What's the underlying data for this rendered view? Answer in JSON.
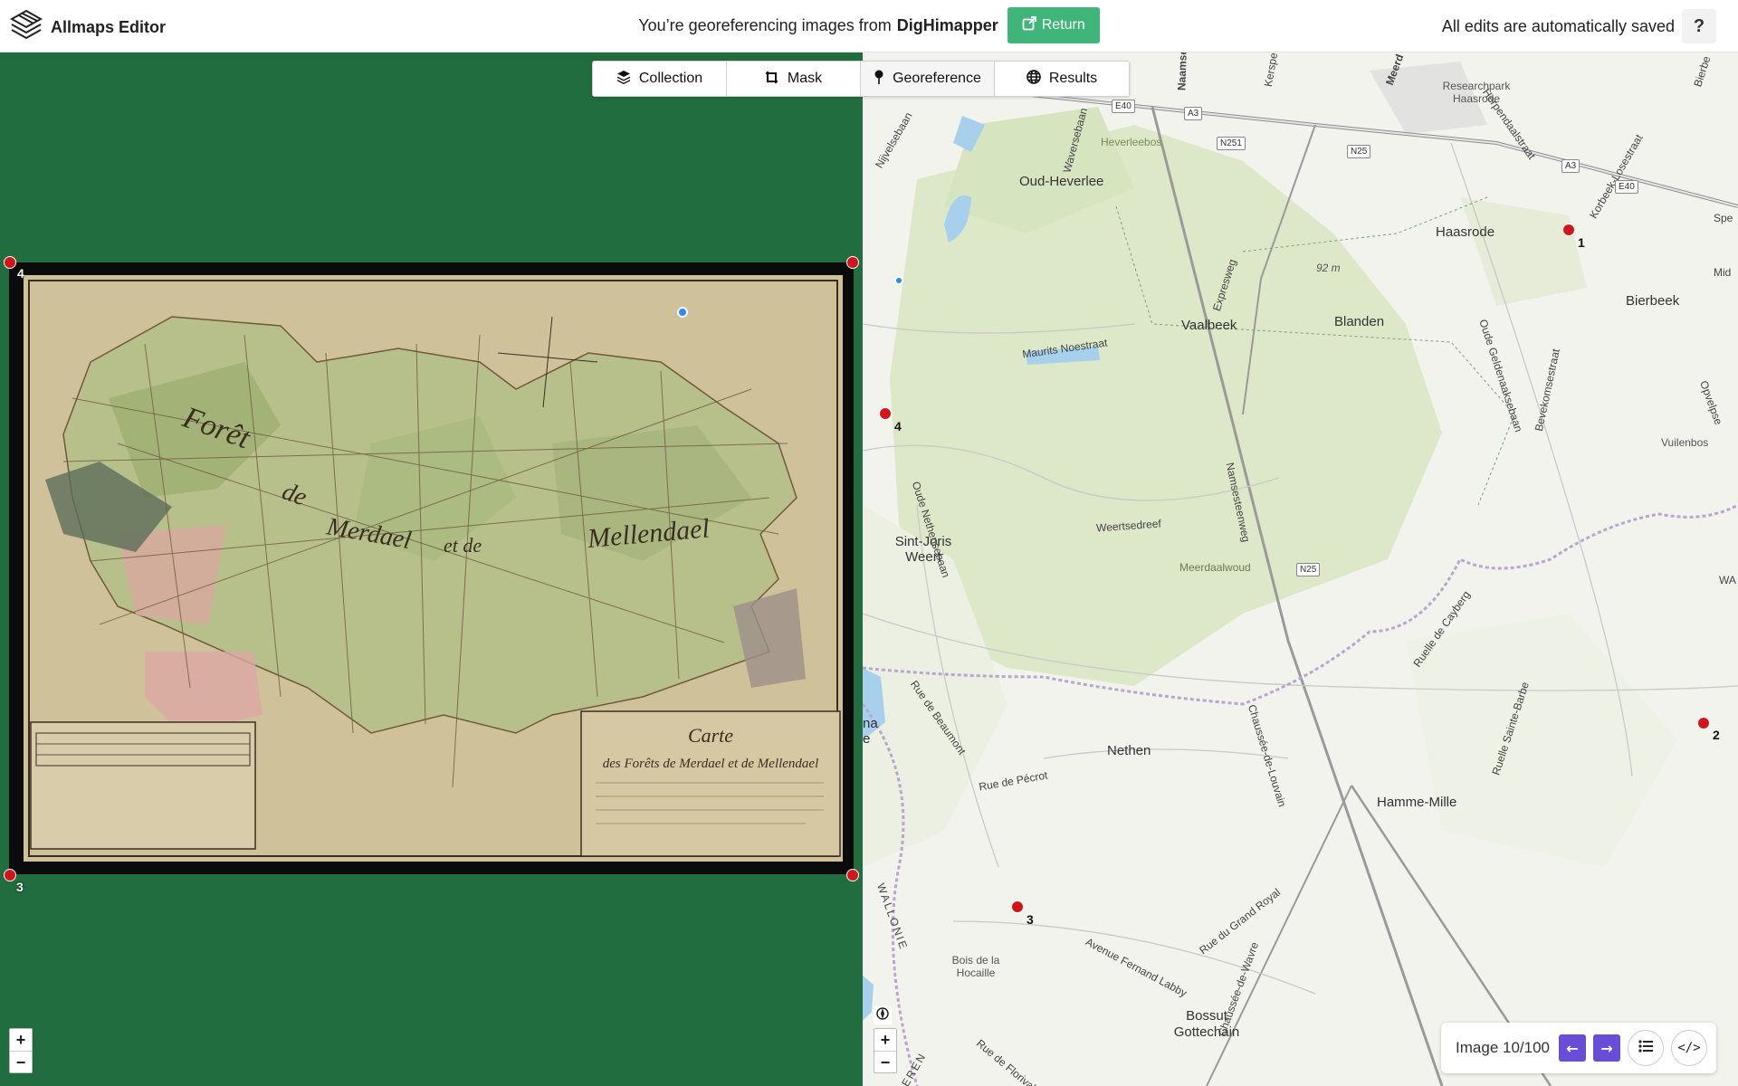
{
  "app": {
    "name": "Allmaps Editor",
    "message_prefix": "You’re georeferencing images from",
    "message_source": "DigHimapper",
    "return_label": "Return",
    "saved_status": "All edits are automatically saved",
    "help_label": "?"
  },
  "tabs": [
    {
      "label": "Collection",
      "icon": "layers-icon"
    },
    {
      "label": "Mask",
      "icon": "crop-icon"
    },
    {
      "label": "Georeference",
      "icon": "pin-icon"
    },
    {
      "label": "Results",
      "icon": "globe-icon"
    }
  ],
  "gcps_image": [
    {
      "label": "4"
    },
    {
      "label": "3"
    }
  ],
  "gcps_map": [
    {
      "label": "1"
    },
    {
      "label": "4"
    },
    {
      "label": "2"
    },
    {
      "label": "3"
    }
  ],
  "zoom": {
    "in": "+",
    "out": "−"
  },
  "map_labels": {
    "research_park": "Researchpark Haasrode",
    "heverleebos": "Heverleebos",
    "oud_heverlee": "Oud-Heverlee",
    "haasrode": "Haasrode",
    "bierbeek": "Bierbeek",
    "vaalbeek": "Vaalbeek",
    "blanden": "Blanden",
    "elev": "92 m",
    "sint_joris": "Sint-Joris Weert",
    "weertsedreef": "Weertsedreef",
    "meerdaalwoud": "Meerdaalwoud",
    "nethen": "Nethen",
    "hamme_mille": "Hamme-Mille",
    "bois": "Bois de la Hocaille",
    "bossut": "Bossut Gottechain",
    "vuilenbos": "Vuilenbos",
    "maurits": "Maurits Noestraat",
    "namsesteenweg": "Namsesteenweg",
    "chaussee": "Chaussée-de-Louvain",
    "rue_pecrot": "Rue de Pécrot",
    "rue_beaumont": "Rue de Beaumont",
    "avenue_labby": "Avenue Fernand Labby",
    "rue_grand_royal": "Rue du Grand Royal",
    "chaussee_wavre": "Chaussée-de-Wavre",
    "wallonie": "WALLONIE",
    "expresweg": "Expresweg",
    "oude_geldenaaksebaan": "Oude Geldenaaksebaan",
    "bevekomsestraat": "Bevekomsestraat",
    "ruelle_cayberg": "Ruelle de Cayberg",
    "ruelle_barbe": "Ruelle Sainte-Barbe",
    "oude_nethensebaan": "Oude Nethensebaan",
    "rue_florival": "Rue de Florival",
    "derenbaan": "NDEREN",
    "nijvelsebaan": "Nijvelsebaan",
    "waversebaan": "Waversebaan",
    "herpendaalstraat": "Herpendaalstraat",
    "korbeek": "Korbeek-Losestraat",
    "na_e": "na",
    "e": "e",
    "spe": "Spe",
    "mid": "Mid",
    "opvelpse": "Opvelpse",
    "wa": "WA",
    "kerspe": "Kerspe",
    "naamse": "Naamse",
    "meerd": "Meerd",
    "bierbe": "Bierbe"
  },
  "shields": {
    "e40a": "E40",
    "a3a": "A3",
    "n251": "N251",
    "n25a": "N25",
    "a3b": "A3",
    "e40b": "E40",
    "n25b": "N25"
  },
  "map_image_texts": {
    "title1": "Carte",
    "title2": "des Forêts de Merdael et de Mellendael",
    "foret": "Forêt",
    "de": "de",
    "merdael": "Merdael",
    "et_de": "et de",
    "mellendael": "Mellendael"
  },
  "pager": {
    "text": "Image 10/100",
    "prev": "←",
    "next": "→",
    "list_icon": "list-icon",
    "code_label": "</>"
  }
}
